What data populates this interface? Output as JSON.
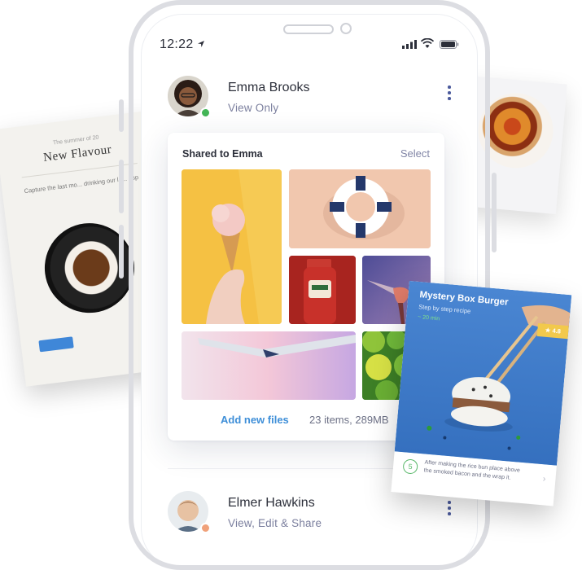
{
  "bg_left_card": {
    "small": "The summer of 20",
    "title": "New Flavour",
    "body": "Capture the last mo... drinking our la... esp"
  },
  "status_bar": {
    "time": "12:22"
  },
  "users": [
    {
      "name": "Emma Brooks",
      "role": "View Only",
      "status_color": "#43b556"
    },
    {
      "name": "Elmer Hawkins",
      "role": "View, Edit & Share",
      "status_color": "#f0a17a"
    }
  ],
  "shared": {
    "title": "Shared to Emma",
    "select_label": "Select",
    "add_files_label": "Add new files",
    "items_summary": "23 items, 289MB"
  },
  "recipe": {
    "title": "Mystery Box Burger",
    "subtitle": "Step by step recipe",
    "time": "~ 20 min",
    "rating": "4.8",
    "step_number": "5",
    "step_text": "After making the rice bun place above the smoked bacon and the wrap it."
  },
  "colors": {
    "accent_blue": "#3f8fd8",
    "muted_text": "#7b7f9e",
    "kebab": "#4b5a9c",
    "online_green": "#43b556"
  },
  "icons": {
    "location": "location-arrow-icon",
    "signal": "signal-icon",
    "wifi": "wifi-icon",
    "battery": "battery-icon",
    "more": "kebab-menu-icon",
    "star": "star-icon"
  }
}
